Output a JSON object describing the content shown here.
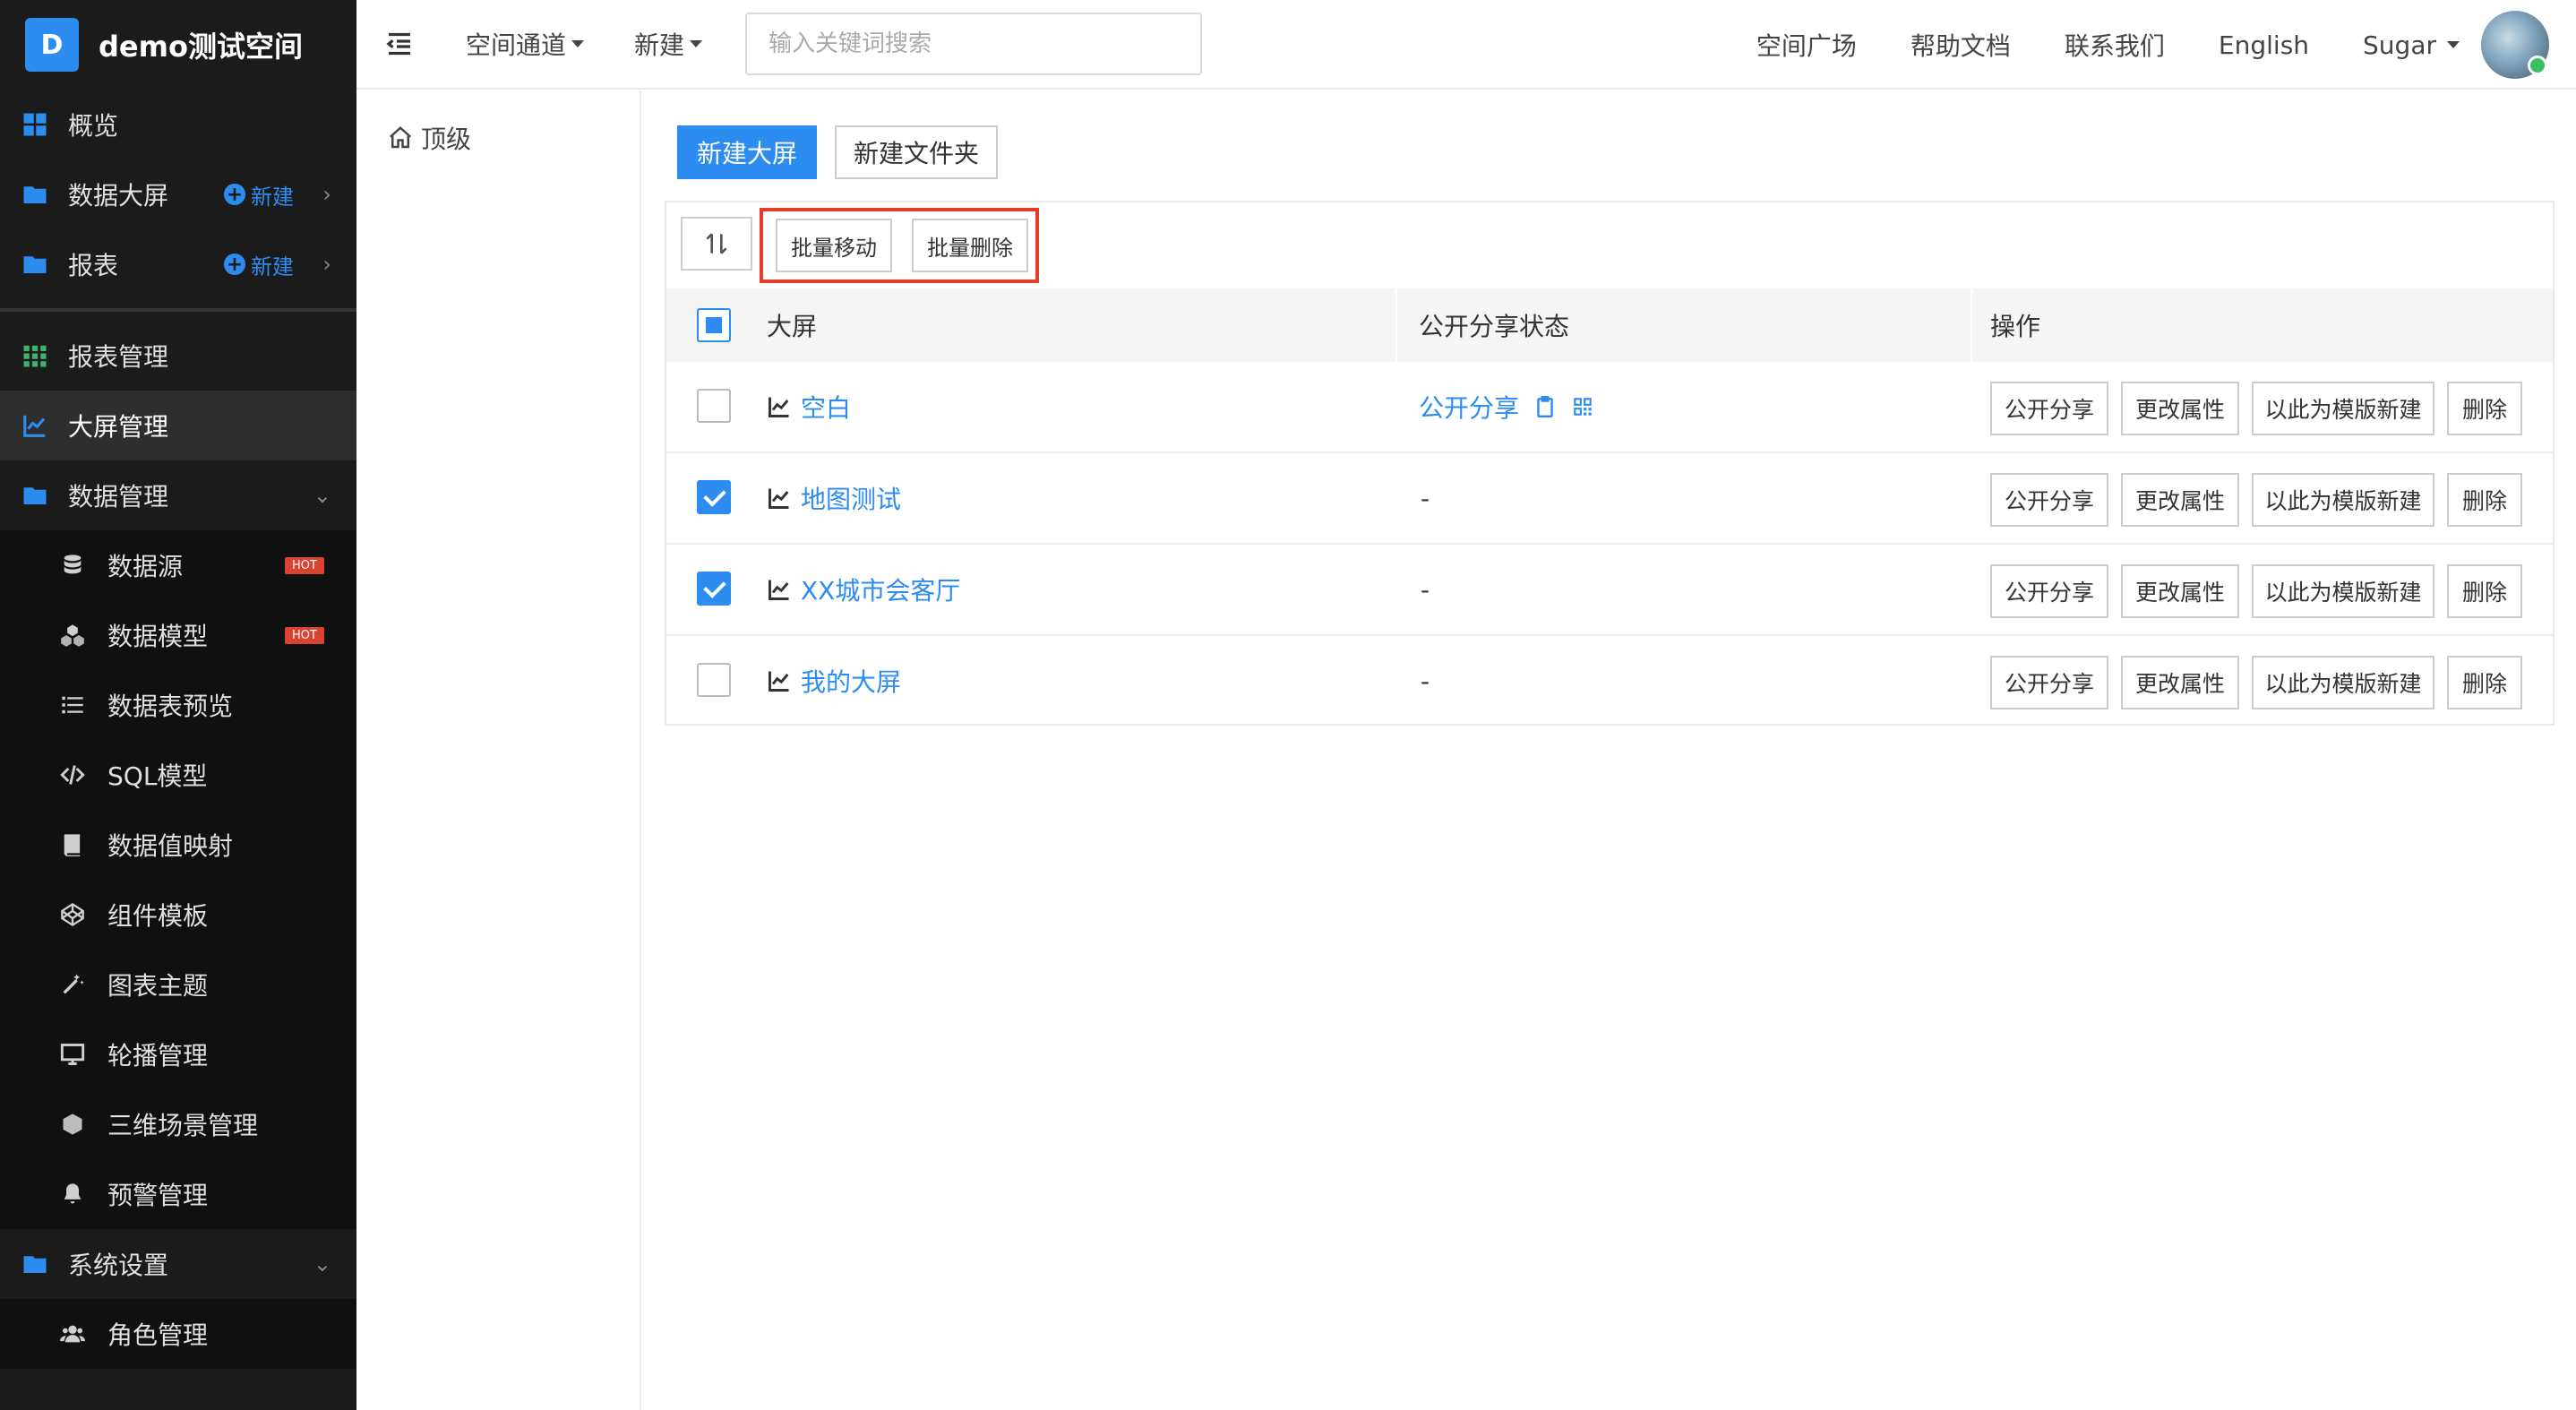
{
  "brand": {
    "logo_letter": "D",
    "name": "demo测试空间"
  },
  "sidebar": {
    "top_items": [
      {
        "label": "概览"
      },
      {
        "label": "数据大屏",
        "new_label": "新建"
      },
      {
        "label": "报表",
        "new_label": "新建"
      }
    ],
    "manage_items": [
      {
        "label": "报表管理"
      },
      {
        "label": "大屏管理"
      },
      {
        "label": "数据管理"
      }
    ],
    "data_sub_items": [
      {
        "label": "数据源",
        "badge": "HOT"
      },
      {
        "label": "数据模型",
        "badge": "HOT"
      },
      {
        "label": "数据表预览"
      },
      {
        "label": "SQL模型"
      },
      {
        "label": "数据值映射"
      },
      {
        "label": "组件模板"
      },
      {
        "label": "图表主题"
      },
      {
        "label": "轮播管理"
      },
      {
        "label": "三维场景管理"
      },
      {
        "label": "预警管理"
      }
    ],
    "settings_group": {
      "label": "系统设置"
    },
    "settings_sub_items": [
      {
        "label": "角色管理"
      }
    ]
  },
  "header": {
    "nav": [
      {
        "label": "空间通道"
      },
      {
        "label": "新建"
      }
    ],
    "search_placeholder": "输入关键词搜索",
    "links": [
      {
        "label": "空间广场"
      },
      {
        "label": "帮助文档"
      },
      {
        "label": "联系我们"
      },
      {
        "label": "English"
      }
    ],
    "user_name": "Sugar"
  },
  "folders": {
    "root_label": "顶级"
  },
  "actions": {
    "new_screen": "新建大屏",
    "new_folder": "新建文件夹"
  },
  "toolbar": {
    "batch_move": "批量移动",
    "batch_delete": "批量删除"
  },
  "table": {
    "columns": {
      "name": "大屏",
      "share": "公开分享状态",
      "ops": "操作"
    },
    "op_labels": {
      "share": "公开分享",
      "props": "更改属性",
      "template": "以此为模版新建",
      "delete": "删除"
    },
    "rows": [
      {
        "name": "空白",
        "share_status": "公开分享",
        "checked": false
      },
      {
        "name": "地图测试",
        "share_status": "-",
        "checked": true
      },
      {
        "name": "XX城市会客厅",
        "share_status": "-",
        "checked": true
      },
      {
        "name": "我的大屏",
        "share_status": "-",
        "checked": false
      }
    ]
  },
  "colors": {
    "accent": "#2d8cf0",
    "sidebar_bg": "#1b1b1b",
    "highlight": "#e53a2c",
    "hot_badge": "#d9432f"
  }
}
